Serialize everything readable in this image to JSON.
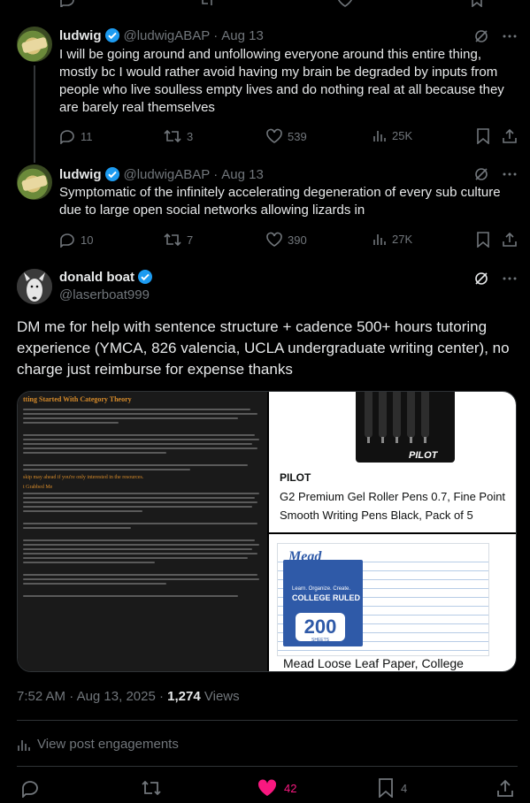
{
  "replies": [
    {
      "name": "ludwig",
      "handle": "@ludwigABAP",
      "date": "Aug 13",
      "text": "I will be going around and unfollowing everyone around this entire thing, mostly bc I would rather avoid having my brain be degraded by inputs from people who live soulless empty lives and do nothing real at all because they are barely real themselves",
      "replies": "11",
      "reposts": "3",
      "likes": "539",
      "views": "25K"
    },
    {
      "name": "ludwig",
      "handle": "@ludwigABAP",
      "date": "Aug 13",
      "text": "Symptomatic of the infinitely accelerating degeneration of every sub culture due to large open social networks allowing lizards in",
      "replies": "10",
      "reposts": "7",
      "likes": "390",
      "views": "27K"
    }
  ],
  "main": {
    "name": "donald boat",
    "handle": "@laserboat999",
    "text": "DM me for help with sentence structure + cadence 500+ hours tutoring experience (YMCA, 826 valencia, UCLA undergraduate writing center), no charge just reimburse for expense thanks",
    "media": {
      "doc_title": "tting Started With Category Theory",
      "doc_heading1": "t Grabbed Me",
      "doc_heading2": "skip may ahead if you're only interested in the resources.",
      "product1_brand": "PILOT",
      "product1_logo": "PILOT",
      "product1_desc": "G2 Premium Gel Roller Pens 0.7, Fine Point Smooth Writing Pens Black, Pack of 5",
      "product2_logo": "Mead",
      "product2_sub": "Learn. Organize. Create.",
      "product2_ruled": "COLLEGE RULED",
      "product2_count": "200",
      "product2_sheets": "SHEETS",
      "product2_desc": "Mead Loose Leaf Paper, College"
    },
    "time": "7:52 AM",
    "date": "Aug 13, 2025",
    "views_count": "1,274",
    "views_label": "Views",
    "engagements_label": "View post engagements",
    "likes": "42",
    "bookmarks": "4"
  },
  "colors": {
    "background": "#000000",
    "text": "#e7e9ea",
    "muted": "#71767b",
    "verified": "#1d9bf0",
    "like_active": "#f91880",
    "divider": "#2f3336"
  },
  "icons": [
    "reply-icon",
    "repost-icon",
    "like-icon",
    "views-icon",
    "bookmark-icon",
    "share-icon",
    "grok-icon",
    "more-icon",
    "verified-icon"
  ]
}
